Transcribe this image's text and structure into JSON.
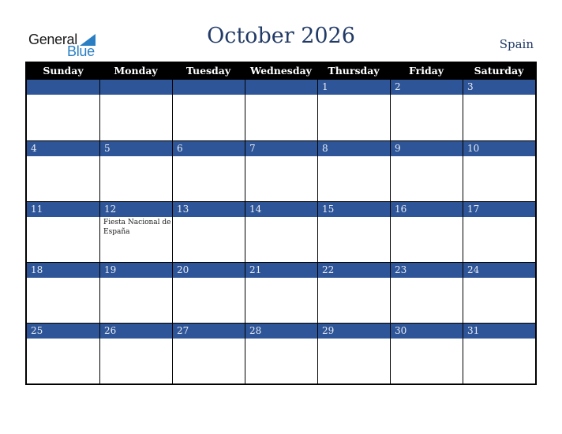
{
  "logo": {
    "word1": "General",
    "word2": "Blue",
    "brand_color": "#2a7fc4"
  },
  "title": "October 2026",
  "country": "Spain",
  "colors": {
    "header_bg": "#000000",
    "date_band": "#2e5597",
    "title": "#213a66"
  },
  "weekdays": [
    "Sunday",
    "Monday",
    "Tuesday",
    "Wednesday",
    "Thursday",
    "Friday",
    "Saturday"
  ],
  "weeks": [
    [
      {
        "day": ""
      },
      {
        "day": ""
      },
      {
        "day": ""
      },
      {
        "day": ""
      },
      {
        "day": "1"
      },
      {
        "day": "2"
      },
      {
        "day": "3"
      }
    ],
    [
      {
        "day": "4"
      },
      {
        "day": "5"
      },
      {
        "day": "6"
      },
      {
        "day": "7"
      },
      {
        "day": "8"
      },
      {
        "day": "9"
      },
      {
        "day": "10"
      }
    ],
    [
      {
        "day": "11"
      },
      {
        "day": "12",
        "holiday": "Fiesta Nacional de España"
      },
      {
        "day": "13"
      },
      {
        "day": "14"
      },
      {
        "day": "15"
      },
      {
        "day": "16"
      },
      {
        "day": "17"
      }
    ],
    [
      {
        "day": "18"
      },
      {
        "day": "19"
      },
      {
        "day": "20"
      },
      {
        "day": "21"
      },
      {
        "day": "22"
      },
      {
        "day": "23"
      },
      {
        "day": "24"
      }
    ],
    [
      {
        "day": "25"
      },
      {
        "day": "26"
      },
      {
        "day": "27"
      },
      {
        "day": "28"
      },
      {
        "day": "29"
      },
      {
        "day": "30"
      },
      {
        "day": "31"
      }
    ]
  ]
}
